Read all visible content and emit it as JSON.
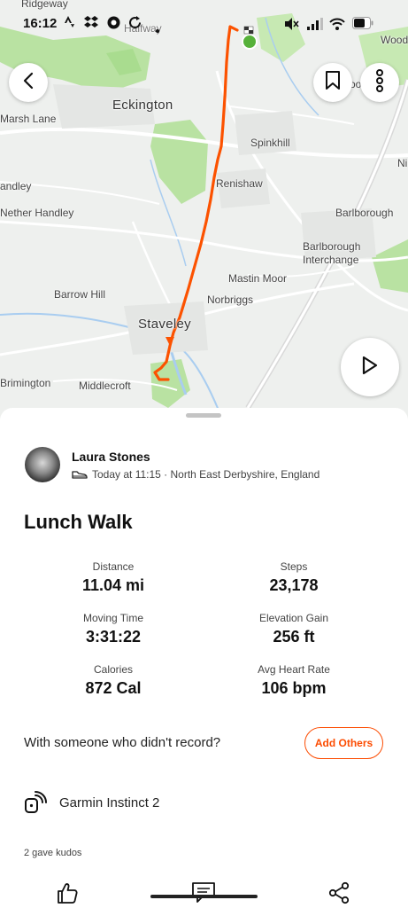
{
  "status_bar": {
    "time": "16:12",
    "icons": [
      "strava-icon",
      "dropbox-icon",
      "chrome-icon",
      "sync-icon",
      "dot-icon",
      "mute-icon",
      "signal-icon",
      "wifi-icon",
      "battery-icon"
    ]
  },
  "map": {
    "labels": {
      "edgeway": "Ridgeway",
      "halfway": "Halfway",
      "woodall": "Wood",
      "eckington": "Eckington",
      "marsh_lane": "Marsh Lane",
      "spinkhill": "Spinkhill",
      "handley": "andley",
      "nether_handley": "Nether Handley",
      "renishaw": "Renishaw",
      "barlborough": "Barlborough",
      "barlborough_interchange": "Barlborough\nInterchange",
      "barrow_hill": "Barrow Hill",
      "mastin_moor": "Mastin Moor",
      "norbriggs": "Norbriggs",
      "staveley": "Staveley",
      "brimington": "Brimington",
      "middlecroft": "Middlecroft",
      "ni": "Ni",
      "oo": "oo"
    },
    "route_color": "#fc5200",
    "start_color": "#56b13a"
  },
  "map_buttons": {
    "back": "chevron-left-icon",
    "save": "bookmark-icon",
    "more": "more-vertical-icon",
    "play": "play-icon"
  },
  "athlete": {
    "name": "Laura Stones",
    "meta": "Today at 11:15 · North East Derbyshire, England",
    "activity_icon": "shoe-icon"
  },
  "activity": {
    "title": "Lunch Walk"
  },
  "stats": [
    {
      "label": "Distance",
      "value": "11.04 mi"
    },
    {
      "label": "Steps",
      "value": "23,178"
    },
    {
      "label": "Moving Time",
      "value": "3:31:22"
    },
    {
      "label": "Elevation Gain",
      "value": "256 ft"
    },
    {
      "label": "Calories",
      "value": "872 Cal"
    },
    {
      "label": "Avg Heart Rate",
      "value": "106 bpm"
    }
  ],
  "with_someone": {
    "question": "With someone who didn't record?",
    "button": "Add Others"
  },
  "device": {
    "name": "Garmin Instinct 2",
    "icon": "watch-signal-icon"
  },
  "kudos": "2 gave kudos",
  "actions": [
    "thumbs-up-icon",
    "comment-icon",
    "share-icon"
  ],
  "accent_color": "#fc4c02"
}
